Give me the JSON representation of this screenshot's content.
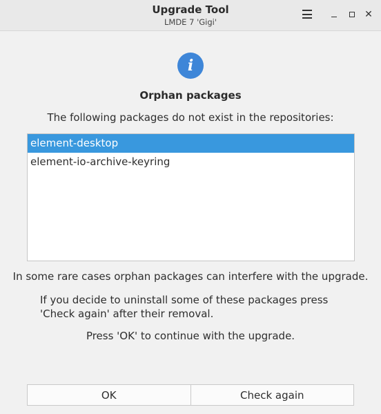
{
  "window": {
    "title": "Upgrade Tool",
    "subtitle": "LMDE 7 'Gigi'",
    "close_glyph": "✕"
  },
  "dialog": {
    "icon": "info-icon",
    "icon_glyph": "i",
    "icon_color": "#3e86d8",
    "heading": "Orphan packages",
    "description": "The following packages do not exist in the repositories:",
    "packages": [
      {
        "name": "element-desktop",
        "selected": true
      },
      {
        "name": "element-io-archive-keyring",
        "selected": false
      }
    ],
    "note_interfere": "In some rare cases orphan packages can interfere with the upgrade.",
    "note_uninstall": "If you decide to uninstall some of these packages press 'Check again' after their removal.",
    "note_continue": "Press 'OK' to continue with the upgrade."
  },
  "buttons": {
    "ok_label": "OK",
    "check_again_label": "Check again"
  },
  "colors": {
    "selection": "#3998de",
    "titlebar": "#e9e9e9",
    "background": "#f1f1f1"
  }
}
